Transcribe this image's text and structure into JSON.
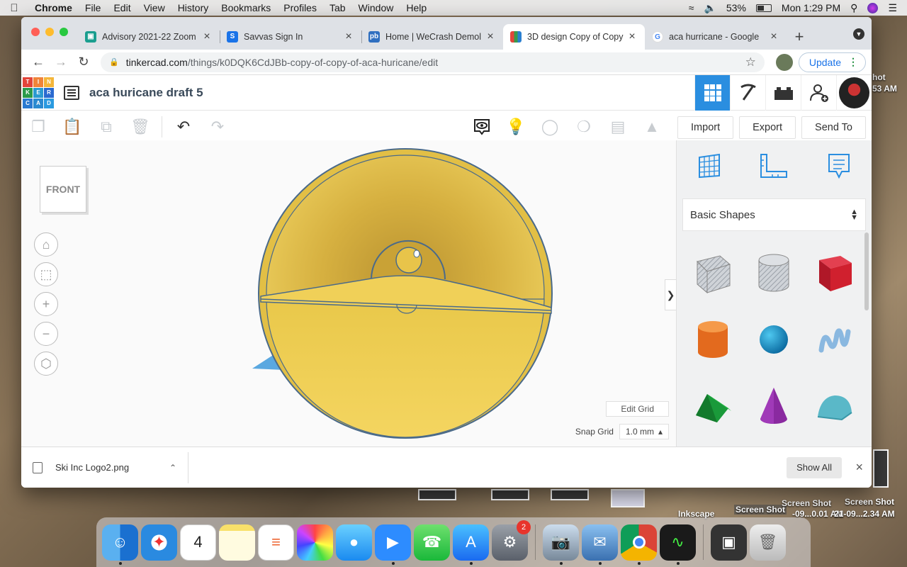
{
  "menubar": {
    "items": [
      "Chrome",
      "File",
      "Edit",
      "View",
      "History",
      "Bookmarks",
      "Profiles",
      "Tab",
      "Window",
      "Help"
    ],
    "battery": "53%",
    "clock": "Mon 1:29 PM"
  },
  "desktop": {
    "labels": [
      "hot",
      "53 AM",
      "Inkscape",
      "Screen Shot",
      "Screen Shot",
      "Screen Shot",
      "-09...0.01 AM",
      "21-09...2.34 AM"
    ]
  },
  "browser": {
    "tabs": [
      {
        "title": "Advisory 2021-22 Zoom",
        "icon": "classroom-icon",
        "color": "#1a9e8f"
      },
      {
        "title": "Savvas Sign In",
        "icon": "savvas-icon",
        "color": "#1a73e8"
      },
      {
        "title": "Home | WeCrash Demol",
        "icon": "wecrash-icon",
        "color": "#2f6fc0"
      },
      {
        "title": "3D design Copy of Copy",
        "icon": "tinkercad-icon",
        "color": "#e2453a"
      },
      {
        "title": "aca hurricane - Google",
        "icon": "google-icon",
        "color": "#4285f4"
      }
    ],
    "url_host": "tinkercad.com",
    "url_path": "/things/k0DQK6CdJBb-copy-of-copy-of-aca-huricane/edit",
    "update_label": "Update"
  },
  "tinkercad": {
    "logo_letters": [
      "T",
      "I",
      "N",
      "K",
      "E",
      "R",
      "C",
      "A",
      "D"
    ],
    "design_name": "aca huricane draft 5",
    "actions": {
      "import": "Import",
      "export": "Export",
      "send_to": "Send To"
    },
    "viewcube_face": "FRONT",
    "edit_grid": "Edit Grid",
    "snap_grid_label": "Snap Grid",
    "snap_grid_value": "1.0 mm",
    "shapes_category": "Basic Shapes",
    "shapes": [
      "box-hole",
      "cylinder-hole",
      "box",
      "cylinder",
      "sphere",
      "scribble",
      "roof",
      "cone",
      "round-roof"
    ],
    "colors": {
      "accent": "#2a8ee0",
      "model": "#e8c44a",
      "model_edge": "#4a6a8a"
    }
  },
  "download": {
    "filename": "Ski Inc Logo2.png",
    "show_all": "Show All"
  }
}
